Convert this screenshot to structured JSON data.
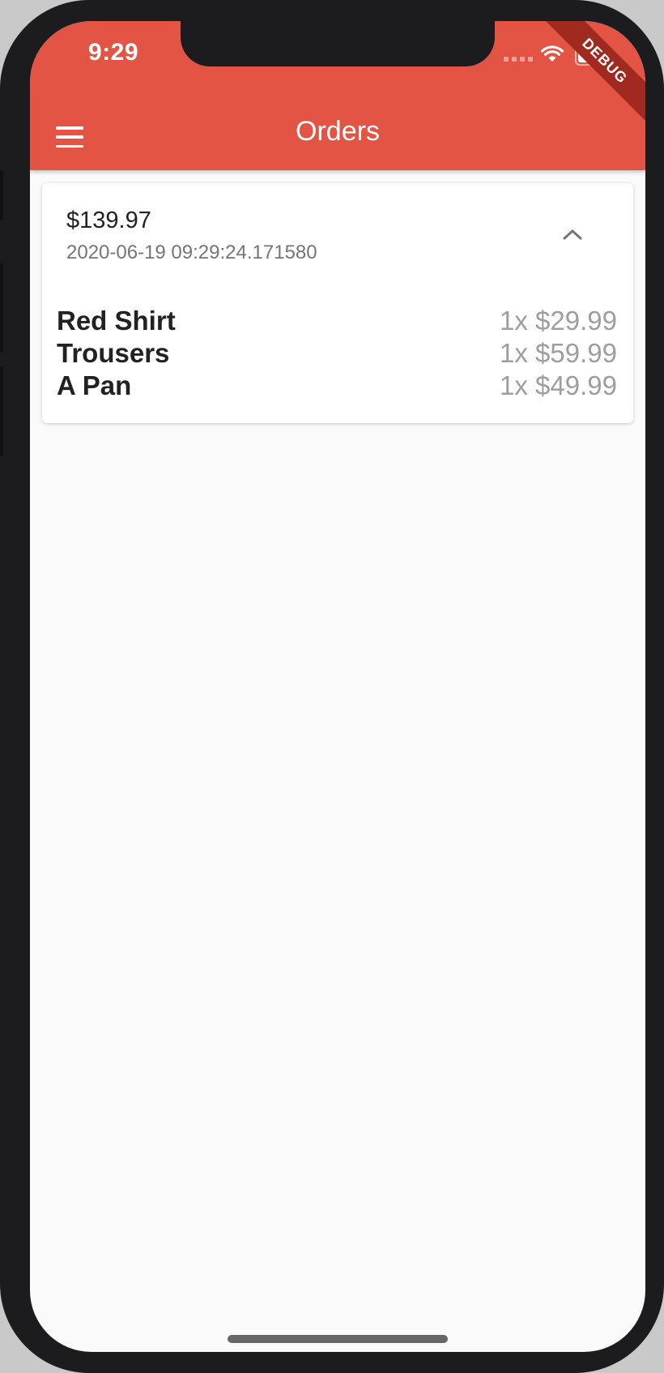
{
  "status_bar": {
    "time": "9:29",
    "debug_label": "DEBUG"
  },
  "app_bar": {
    "title": "Orders",
    "menu_icon": "menu-icon",
    "color": "#e35444"
  },
  "order": {
    "total": "$139.97",
    "date": "2020-06-19 09:29:24.171580",
    "expand_icon": "chevron-up-icon",
    "items": [
      {
        "name": "Red Shirt",
        "qty_price": "1x $29.99"
      },
      {
        "name": "Trousers",
        "qty_price": "1x $59.99"
      },
      {
        "name": "A Pan",
        "qty_price": "1x $49.99"
      }
    ]
  }
}
